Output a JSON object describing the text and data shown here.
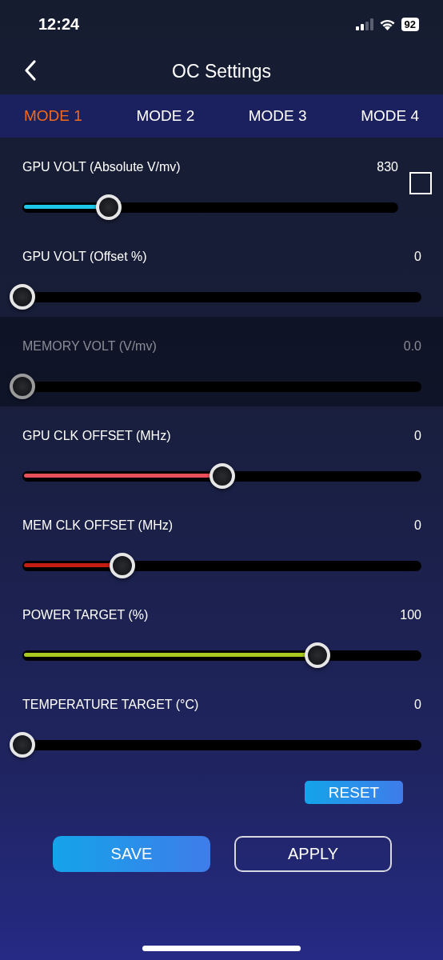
{
  "status_bar": {
    "time": "12:24",
    "battery": "92"
  },
  "nav": {
    "title": "OC Settings"
  },
  "tabs": [
    {
      "label": "MODE 1",
      "selected": true
    },
    {
      "label": "MODE 2",
      "selected": false
    },
    {
      "label": "MODE 3",
      "selected": false
    },
    {
      "label": "MODE 4",
      "selected": false
    }
  ],
  "sliders": [
    {
      "label": "GPU VOLT (Absolute V/mv)",
      "reading": "830",
      "level": 0.23,
      "color": "#1ec8e8",
      "disabled": false,
      "checkbox": {
        "checked": false
      }
    },
    {
      "label": "GPU VOLT (Offset %)",
      "reading": "0",
      "level": 0,
      "disabled": false
    },
    {
      "label": "MEMORY VOLT (V/mv)",
      "reading": "0.0",
      "level": 0,
      "disabled": true
    },
    {
      "label": "GPU CLK OFFSET (MHz)",
      "reading": "0",
      "level": 0.5,
      "color": "#e8505a",
      "disabled": false
    },
    {
      "label": "MEM CLK OFFSET (MHz)",
      "reading": "0",
      "level": 0.25,
      "color": "#c41e12",
      "disabled": false
    },
    {
      "label": "POWER TARGET (%)",
      "reading": "100",
      "level": 0.74,
      "color": "#a8c820",
      "disabled": false
    },
    {
      "label": "TEMPERATURE TARGET (°C)",
      "reading": "0",
      "level": 0,
      "disabled": false
    }
  ],
  "reset_button": "RESET",
  "buttons": [
    {
      "label": "SAVE",
      "kind": "filled"
    },
    {
      "label": "APPLY",
      "kind": "outline"
    }
  ]
}
